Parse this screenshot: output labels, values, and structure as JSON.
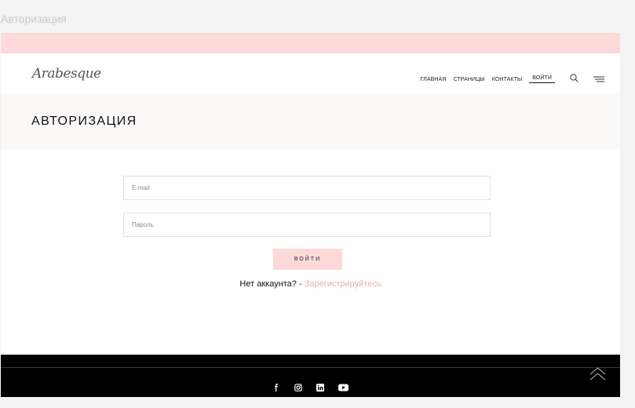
{
  "window": {
    "title": "Авторизация"
  },
  "header": {
    "logo": "Arabesque",
    "nav": [
      {
        "label": "ГЛАВНАЯ"
      },
      {
        "label": "СТРАНИЦЫ"
      },
      {
        "label": "КОНТАКТЫ"
      },
      {
        "label": "ВОЙТИ",
        "active": true
      }
    ],
    "icons": [
      "search-icon",
      "menu-icon"
    ]
  },
  "page_title": "АВТОРИЗАЦИЯ",
  "form": {
    "email_placeholder": "E-mail",
    "password_placeholder": "Пароль",
    "login_label": "ВОЙТИ",
    "no_account": "Нет аккаунта? - ",
    "register_link": "Зарегистрируйтесь"
  },
  "footer": {
    "socials": [
      "facebook-icon",
      "instagram-icon",
      "linkedin-icon",
      "youtube-icon"
    ],
    "scroll_top_icon": "double-chevron-up-icon"
  },
  "colors": {
    "accent_pink": "#fdd9d9",
    "link_pink": "#e8b1a9",
    "footer_bg": "#000000",
    "title_band": "#fbf8f8"
  }
}
